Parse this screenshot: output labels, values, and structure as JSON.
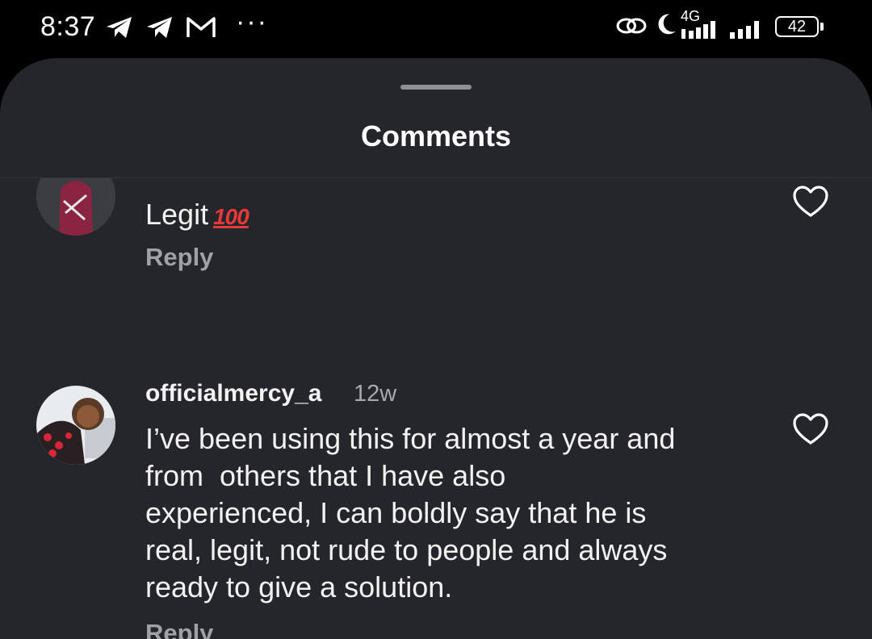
{
  "status_bar": {
    "time": "8:37",
    "network_label": "4G",
    "battery_level": "42"
  },
  "sheet": {
    "title": "Comments"
  },
  "comments": [
    {
      "text": "Legit",
      "emoji_label": "100",
      "reply_label": "Reply"
    },
    {
      "username": "officialmercy_a",
      "timestamp": "12w",
      "text_lines": [
        "I’ve been using this for almost a year and",
        "from  others that I have also",
        "experienced, I can boldly say that he is",
        "real, legit, not rude to people and always",
        "ready to give a solution."
      ],
      "reply_label": "Reply"
    }
  ],
  "colors": {
    "background": "#000000",
    "sheet": "#25262b",
    "text_primary": "#f2f2f2",
    "text_secondary": "#a0a1a6",
    "emoji_red": "#e63a3a"
  }
}
